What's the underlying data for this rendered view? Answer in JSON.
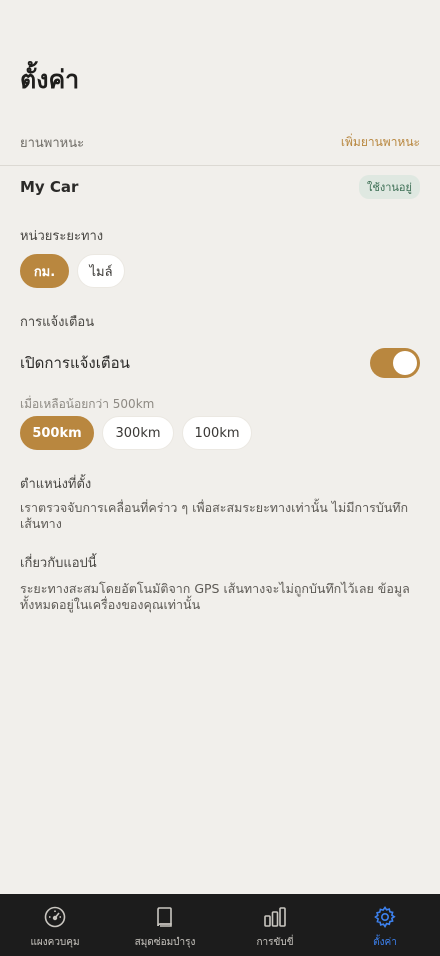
{
  "header": {
    "title": "ตั้งค่า"
  },
  "vehicles": {
    "section_label": "ยานพาหนะ",
    "add_label": "เพิ่มยานพาหนะ",
    "current_name": "My Car",
    "current_badge": "ใช้งานอยู่"
  },
  "units": {
    "label": "หน่วยระยะทาง",
    "options": [
      "กม.",
      "ไมล์"
    ],
    "selected": "กม."
  },
  "notifications": {
    "section_label": "การแจ้งเตือน",
    "toggle_label": "เปิดการแจ้งเตือน",
    "enabled": true,
    "hint": "เมื่อเหลือน้อยกว่า 500km",
    "thresholds": [
      "500km",
      "300km",
      "100km"
    ],
    "selected_threshold": "500km"
  },
  "location": {
    "title": "ตำแหน่งที่ตั้ง",
    "body": "เราตรวจจับการเคลื่อนที่คร่าว ๆ เพื่อสะสมระยะทางเท่านั้น ไม่มีการบันทึกเส้นทาง"
  },
  "about": {
    "title": "เกี่ยวกับแอปนี้",
    "body": "ระยะทางสะสมโดยอัตโนมัติจาก GPS เส้นทางจะไม่ถูกบันทึกไว้เลย ข้อมูลทั้งหมดอยู่ในเครื่องของคุณเท่านั้น"
  },
  "tabbar": {
    "items": [
      {
        "label": "แผงควบคุม",
        "icon": "speedometer-icon"
      },
      {
        "label": "สมุดซ่อมบำรุง",
        "icon": "book-icon"
      },
      {
        "label": "การขับขี่",
        "icon": "bar-chart-icon"
      },
      {
        "label": "ตั้งค่า",
        "icon": "gear-icon"
      }
    ],
    "active_index": 3
  },
  "colors": {
    "accent": "#b9873f",
    "active_tab": "#3d82f0",
    "background": "#f1efeb",
    "tabbar": "#1c1c1c"
  }
}
